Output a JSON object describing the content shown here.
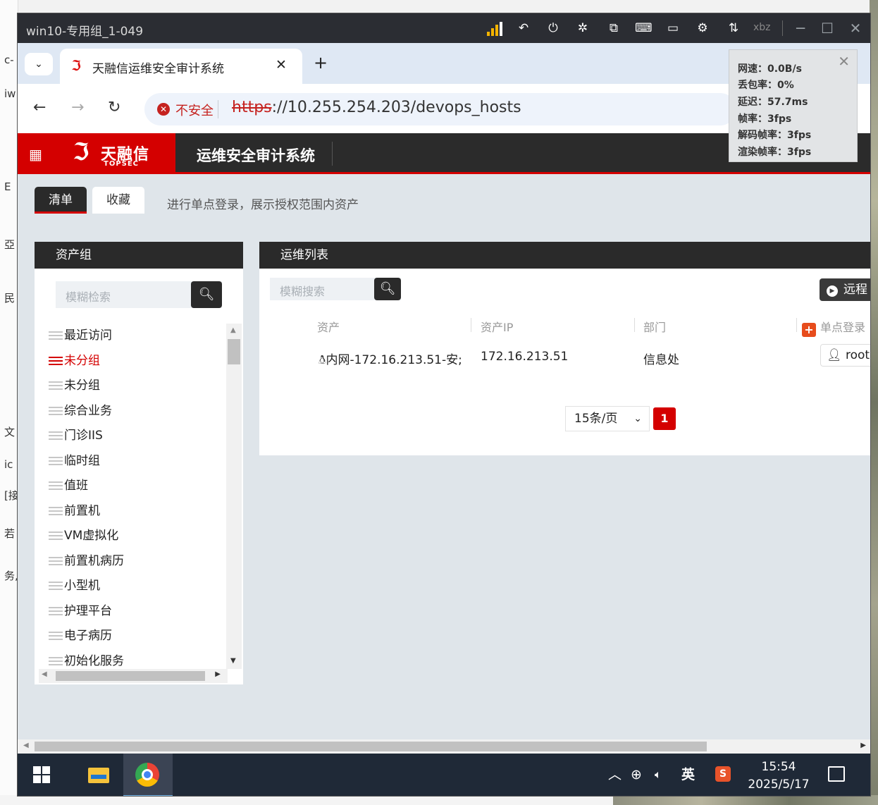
{
  "host": {
    "left_fragments": [
      "c-",
      "iw",
      "E",
      "亞",
      "民",
      "文",
      "ic",
      "[接",
      "若",
      "务,"
    ]
  },
  "remote": {
    "title": "win10-专用组_1-049",
    "user": "xbz",
    "toolbar_icons": [
      "signal-bars-icon",
      "back-arrow-icon",
      "power-icon",
      "fullscreen-exit-icon",
      "clipboard-icon",
      "keyboard-icon",
      "window-icon",
      "settings-icon",
      "transfer-icon"
    ]
  },
  "browser": {
    "tab_title": "天融信运维安全审计系统",
    "insecure_label": "不安全",
    "url_protocol": "https",
    "url_rest": "://10.255.254.203/devops_hosts"
  },
  "app": {
    "logo_cn": "天融信",
    "logo_en": "TOPSEC",
    "system_title": "运维安全审计系统",
    "tabs": [
      {
        "label": "清单",
        "active": true
      },
      {
        "label": "收藏",
        "active": false
      }
    ],
    "hint": "进行单点登录，展示授权范围内资产",
    "asset_group": {
      "title": "资产组",
      "search_placeholder": "模糊检索",
      "items": [
        {
          "label": "最近访问",
          "selected": false
        },
        {
          "label": "未分组",
          "selected": true
        },
        {
          "label": "未分组",
          "selected": false
        },
        {
          "label": "综合业务",
          "selected": false
        },
        {
          "label": "门诊IIS",
          "selected": false
        },
        {
          "label": "临时组",
          "selected": false
        },
        {
          "label": "值班",
          "selected": false
        },
        {
          "label": "前置机",
          "selected": false
        },
        {
          "label": "VM虚拟化",
          "selected": false
        },
        {
          "label": "前置机病历",
          "selected": false
        },
        {
          "label": "小型机",
          "selected": false
        },
        {
          "label": "护理平台",
          "selected": false
        },
        {
          "label": "电子病历",
          "selected": false
        },
        {
          "label": "初始化服务",
          "selected": false
        }
      ]
    },
    "ops_list": {
      "title": "运维列表",
      "search_placeholder": "模糊搜索",
      "remote_button": "远程",
      "columns": {
        "asset": "资产",
        "ip": "资产IP",
        "dept": "部门",
        "sso": "单点登录"
      },
      "rows": [
        {
          "asset": "内网-172.16.213.51-安;",
          "ip": "172.16.213.51",
          "dept": "信息处",
          "account": "root"
        }
      ],
      "page_size": "15条/页",
      "page": "1"
    }
  },
  "stats": {
    "speed": "网速：0.0B/s",
    "loss": "丢包率：0%",
    "latency": "延迟：57.7ms",
    "fps": "帧率：3fps",
    "decode_fps": "解码帧率：3fps",
    "render_fps": "渲染帧率：3fps"
  },
  "taskbar": {
    "ime": "英",
    "time": "15:54",
    "date": "2025/5/17"
  }
}
